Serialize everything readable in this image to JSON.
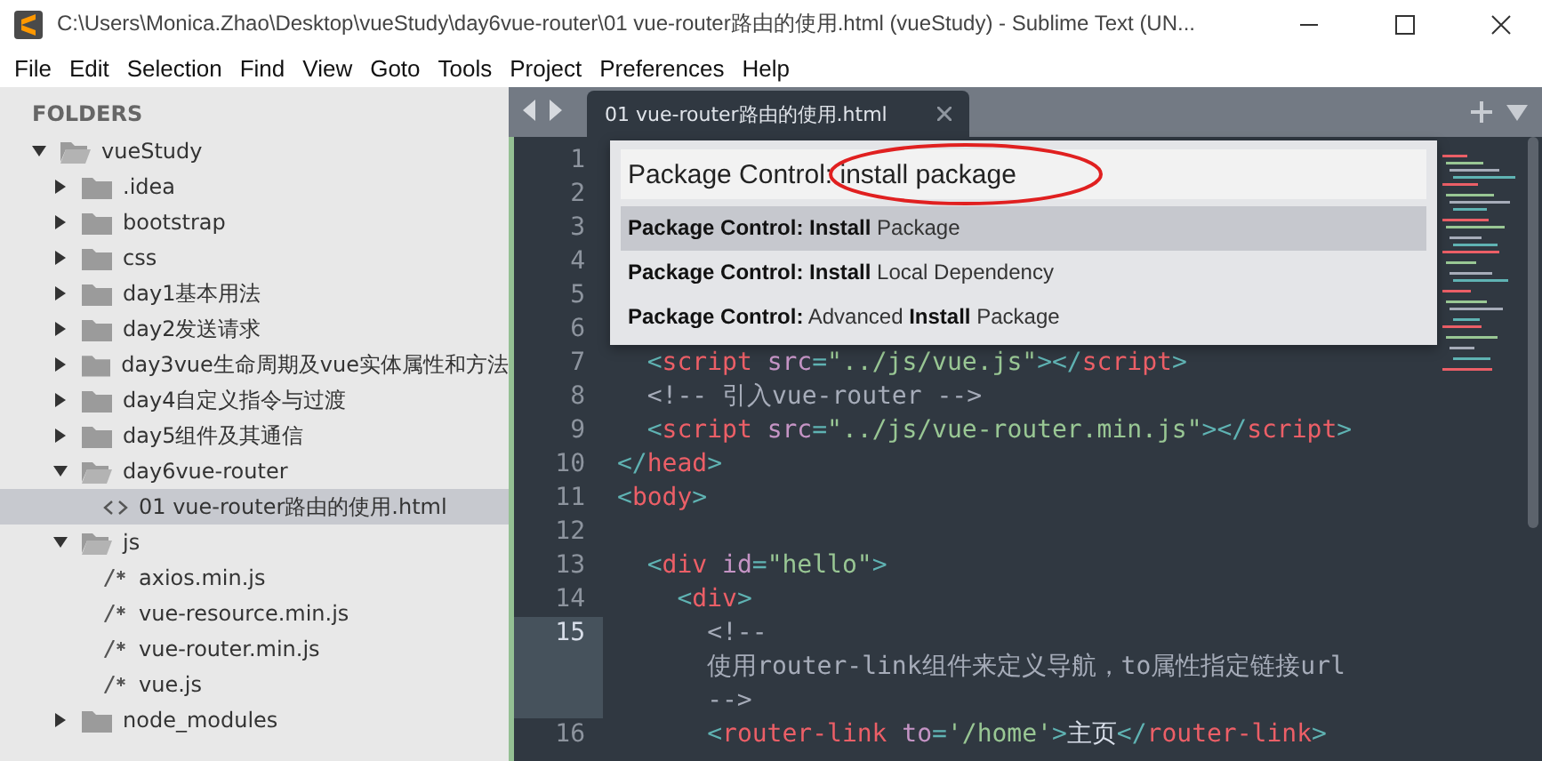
{
  "window": {
    "title": "C:\\Users\\Monica.Zhao\\Desktop\\vueStudy\\day6vue-router\\01 vue-router路由的使用.html (vueStudy) - Sublime Text (UN..."
  },
  "menu": [
    "File",
    "Edit",
    "Selection",
    "Find",
    "View",
    "Goto",
    "Tools",
    "Project",
    "Preferences",
    "Help"
  ],
  "sidebar": {
    "heading": "FOLDERS",
    "tree": [
      {
        "label": "vueStudy",
        "kind": "folder",
        "expanded": true,
        "selected": false,
        "children": [
          {
            "label": ".idea",
            "kind": "folder",
            "expanded": false,
            "selected": false
          },
          {
            "label": "bootstrap",
            "kind": "folder",
            "expanded": false,
            "selected": false
          },
          {
            "label": "css",
            "kind": "folder",
            "expanded": false,
            "selected": false
          },
          {
            "label": "day1基本用法",
            "kind": "folder",
            "expanded": false,
            "selected": false
          },
          {
            "label": "day2发送请求",
            "kind": "folder",
            "expanded": false,
            "selected": false
          },
          {
            "label": "day3vue生命周期及vue实体属性和方法",
            "kind": "folder",
            "expanded": false,
            "selected": false
          },
          {
            "label": "day4自定义指令与过渡",
            "kind": "folder",
            "expanded": false,
            "selected": false
          },
          {
            "label": "day5组件及其通信",
            "kind": "folder",
            "expanded": false,
            "selected": false
          },
          {
            "label": "day6vue-router",
            "kind": "folder",
            "expanded": true,
            "selected": false,
            "children": [
              {
                "label": "01 vue-router路由的使用.html",
                "kind": "markup",
                "selected": true
              }
            ]
          },
          {
            "label": "js",
            "kind": "folder",
            "expanded": true,
            "selected": false,
            "children": [
              {
                "label": "axios.min.js",
                "kind": "script",
                "selected": false
              },
              {
                "label": "vue-resource.min.js",
                "kind": "script",
                "selected": false
              },
              {
                "label": "vue-router.min.js",
                "kind": "script",
                "selected": false
              },
              {
                "label": "vue.js",
                "kind": "script",
                "selected": false
              }
            ]
          },
          {
            "label": "node_modules",
            "kind": "folder",
            "expanded": false,
            "selected": false
          }
        ]
      }
    ]
  },
  "tabs": [
    {
      "label": "01 vue-router路由的使用.html",
      "selected": true
    }
  ],
  "editor": {
    "lines": [
      {
        "number": "1",
        "current": false
      },
      {
        "number": "2",
        "current": false
      },
      {
        "number": "3",
        "current": false
      },
      {
        "number": "4",
        "current": false
      },
      {
        "number": "5",
        "current": false
      },
      {
        "number": "6",
        "current": false
      },
      {
        "number": "7",
        "current": false,
        "rows": [
          [
            {
              "kind": "punct",
              "text": "  <"
            },
            {
              "kind": "tag",
              "text": "script"
            },
            {
              "kind": "text",
              "text": " "
            },
            {
              "kind": "attr",
              "text": "src"
            },
            {
              "kind": "punct",
              "text": "="
            },
            {
              "kind": "string",
              "text": "\"../js/vue.js\""
            },
            {
              "kind": "punct",
              "text": ">"
            },
            {
              "kind": "punct",
              "text": "</"
            },
            {
              "kind": "tag",
              "text": "script"
            },
            {
              "kind": "punct",
              "text": ">"
            }
          ]
        ]
      },
      {
        "number": "8",
        "current": false,
        "rows": [
          [
            {
              "kind": "comment",
              "text": "  <!-- 引入vue-router -->"
            }
          ]
        ]
      },
      {
        "number": "9",
        "current": false,
        "rows": [
          [
            {
              "kind": "punct",
              "text": "  <"
            },
            {
              "kind": "tag",
              "text": "script"
            },
            {
              "kind": "text",
              "text": " "
            },
            {
              "kind": "attr",
              "text": "src"
            },
            {
              "kind": "punct",
              "text": "="
            },
            {
              "kind": "string",
              "text": "\"../js/vue-router.min.js\""
            },
            {
              "kind": "punct",
              "text": ">"
            },
            {
              "kind": "punct",
              "text": "</"
            },
            {
              "kind": "tag",
              "text": "script"
            },
            {
              "kind": "punct",
              "text": ">"
            }
          ]
        ]
      },
      {
        "number": "10",
        "current": false,
        "rows": [
          [
            {
              "kind": "punct",
              "text": "</"
            },
            {
              "kind": "tag",
              "text": "head"
            },
            {
              "kind": "punct",
              "text": ">"
            }
          ]
        ]
      },
      {
        "number": "11",
        "current": false,
        "rows": [
          [
            {
              "kind": "punct",
              "text": "<"
            },
            {
              "kind": "tag",
              "text": "body"
            },
            {
              "kind": "punct",
              "text": ">"
            }
          ]
        ]
      },
      {
        "number": "12",
        "current": false
      },
      {
        "number": "13",
        "current": false,
        "rows": [
          [
            {
              "kind": "punct",
              "text": "  <"
            },
            {
              "kind": "tag",
              "text": "div"
            },
            {
              "kind": "text",
              "text": " "
            },
            {
              "kind": "attr",
              "text": "id"
            },
            {
              "kind": "punct",
              "text": "="
            },
            {
              "kind": "string",
              "text": "\"hello\""
            },
            {
              "kind": "punct",
              "text": ">"
            }
          ]
        ]
      },
      {
        "number": "14",
        "current": false,
        "rows": [
          [
            {
              "kind": "punct",
              "text": "    <"
            },
            {
              "kind": "tag",
              "text": "div"
            },
            {
              "kind": "punct",
              "text": ">"
            }
          ]
        ]
      },
      {
        "number": "15",
        "current": true,
        "rows": [
          [
            {
              "kind": "comment",
              "text": "      <!--"
            }
          ],
          [
            {
              "kind": "comment",
              "text": "      使用router-link组件来定义导航，to属性指定链接url"
            }
          ],
          [
            {
              "kind": "comment",
              "text": "      -->"
            }
          ]
        ]
      },
      {
        "number": "16",
        "current": false,
        "rows": [
          [
            {
              "kind": "punct",
              "text": "      <"
            },
            {
              "kind": "tag",
              "text": "router-link"
            },
            {
              "kind": "text",
              "text": " "
            },
            {
              "kind": "attr",
              "text": "to"
            },
            {
              "kind": "punct",
              "text": "="
            },
            {
              "kind": "string",
              "text": "'/home'"
            },
            {
              "kind": "punct",
              "text": ">"
            },
            {
              "kind": "text",
              "text": "主页"
            },
            {
              "kind": "punct",
              "text": "</"
            },
            {
              "kind": "tag",
              "text": "router-link"
            },
            {
              "kind": "punct",
              "text": ">"
            }
          ]
        ]
      }
    ]
  },
  "palette": {
    "query": "Package Control: install package",
    "items": [
      {
        "label": "**Package Control: Install** Package",
        "selected": true
      },
      {
        "label": "**Package Control: Install** Local Dependency",
        "selected": false
      },
      {
        "label": "**Package Control:** Advanced **Install** Package",
        "selected": false
      }
    ]
  }
}
